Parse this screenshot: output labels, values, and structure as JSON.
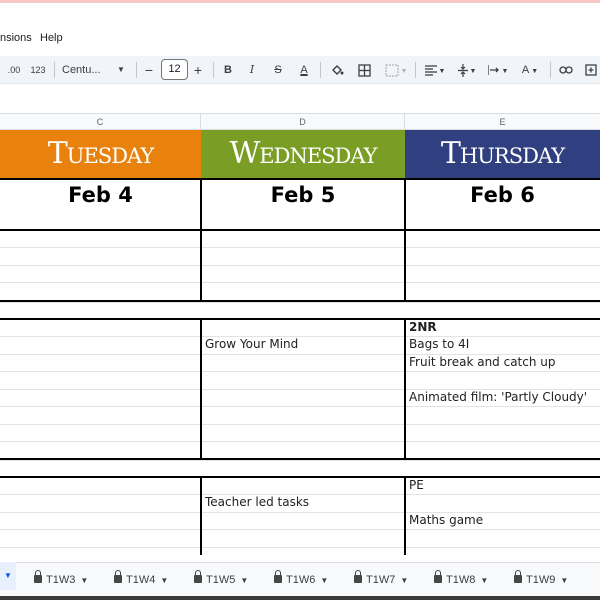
{
  "menu": {
    "extensions_fragment": "nsions",
    "help": "Help"
  },
  "toolbar": {
    "decimal_label": ".00",
    "format_123": "123",
    "font_name": "Centu...",
    "font_size": "12",
    "minus": "−",
    "plus": "+",
    "bold": "B",
    "italic": "I",
    "strike": "S",
    "text_color": "A"
  },
  "columns": {
    "c": "C",
    "d": "D",
    "e": "E"
  },
  "days": {
    "tuesday": {
      "name": "Tuesday",
      "date": "Feb 4",
      "color": "#e8820c"
    },
    "wednesday": {
      "name": "Wednesday",
      "date": "Feb 5",
      "color": "#7a9e25"
    },
    "thursday": {
      "name": "Thursday",
      "date": "Feb 6",
      "color": "#2f3f7f"
    }
  },
  "cells": {
    "wed_grow": "Grow Your Mind",
    "thu_2nr": "2NR",
    "thu_bags": "Bags to 4I",
    "thu_fruit": "Fruit break and catch up",
    "thu_film": "Animated film: 'Partly Cloudy'",
    "wed_teacher": "Teacher led tasks",
    "thu_pe": "PE",
    "thu_maths": "Maths game"
  },
  "tabs": [
    {
      "label": "T1W3"
    },
    {
      "label": "T1W4"
    },
    {
      "label": "T1W5"
    },
    {
      "label": "T1W6"
    },
    {
      "label": "T1W7"
    },
    {
      "label": "T1W8"
    },
    {
      "label": "T1W9"
    }
  ]
}
